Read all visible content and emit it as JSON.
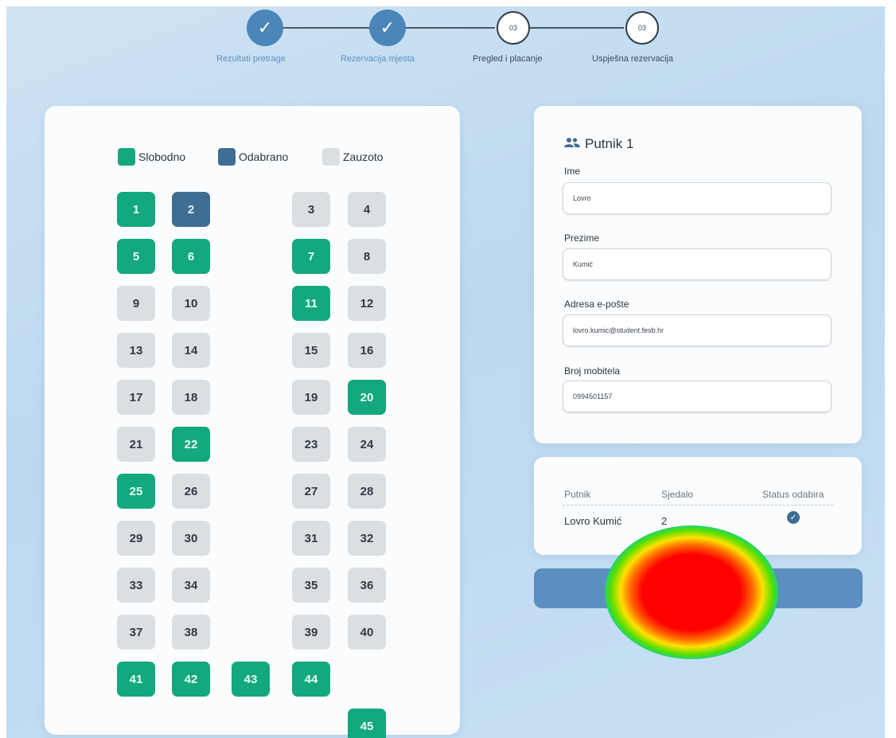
{
  "stepper": {
    "steps": [
      {
        "badge": "✓",
        "label": "Rezultati pretrage",
        "state": "done"
      },
      {
        "badge": "✓",
        "label": "Rezervacija mjesta",
        "state": "done"
      },
      {
        "badge": "03",
        "label": "Pregled i placanje",
        "state": "todo"
      },
      {
        "badge": "03",
        "label": "Uspješna rezervacija",
        "state": "todo"
      }
    ]
  },
  "legend": {
    "free": "Slobodno",
    "selected": "Odabrano",
    "taken": "Zauzoto"
  },
  "colors": {
    "free": "#13a87e",
    "selected": "#3f6d93",
    "taken": "#dcdfe2",
    "accent": "#5b8fbf"
  },
  "seats": [
    {
      "n": "1",
      "s": "free"
    },
    {
      "n": "2",
      "s": "selected"
    },
    {
      "n": "3",
      "s": "taken"
    },
    {
      "n": "4",
      "s": "taken"
    },
    {
      "n": "5",
      "s": "free"
    },
    {
      "n": "6",
      "s": "free"
    },
    {
      "n": "7",
      "s": "free"
    },
    {
      "n": "8",
      "s": "taken"
    },
    {
      "n": "9",
      "s": "taken"
    },
    {
      "n": "10",
      "s": "taken"
    },
    {
      "n": "11",
      "s": "free"
    },
    {
      "n": "12",
      "s": "taken"
    },
    {
      "n": "13",
      "s": "taken"
    },
    {
      "n": "14",
      "s": "taken"
    },
    {
      "n": "15",
      "s": "taken"
    },
    {
      "n": "16",
      "s": "taken"
    },
    {
      "n": "17",
      "s": "taken"
    },
    {
      "n": "18",
      "s": "taken"
    },
    {
      "n": "19",
      "s": "taken"
    },
    {
      "n": "20",
      "s": "free"
    },
    {
      "n": "21",
      "s": "taken"
    },
    {
      "n": "22",
      "s": "free"
    },
    {
      "n": "23",
      "s": "taken"
    },
    {
      "n": "24",
      "s": "taken"
    },
    {
      "n": "25",
      "s": "free"
    },
    {
      "n": "26",
      "s": "taken"
    },
    {
      "n": "27",
      "s": "taken"
    },
    {
      "n": "28",
      "s": "taken"
    },
    {
      "n": "29",
      "s": "taken"
    },
    {
      "n": "30",
      "s": "taken"
    },
    {
      "n": "31",
      "s": "taken"
    },
    {
      "n": "32",
      "s": "taken"
    },
    {
      "n": "33",
      "s": "taken"
    },
    {
      "n": "34",
      "s": "taken"
    },
    {
      "n": "35",
      "s": "taken"
    },
    {
      "n": "36",
      "s": "taken"
    },
    {
      "n": "37",
      "s": "taken"
    },
    {
      "n": "38",
      "s": "taken"
    },
    {
      "n": "39",
      "s": "taken"
    },
    {
      "n": "40",
      "s": "taken"
    },
    {
      "n": "41",
      "s": "free"
    },
    {
      "n": "42",
      "s": "free"
    },
    {
      "n": "43",
      "s": "free"
    },
    {
      "n": "44",
      "s": "free"
    },
    {
      "n": "45",
      "s": "free"
    }
  ],
  "passenger": {
    "title": "Putnik 1",
    "icon": "users-icon",
    "first_name_label": "Ime",
    "first_name_value": "Lovro",
    "last_name_label": "Prezime",
    "last_name_value": "Kumić",
    "email_label": "Adresa e-pošte",
    "email_value": "lovro.kumic@student.fesb.hr",
    "phone_label": "Broj mobitela",
    "phone_value": "0994501157"
  },
  "summary": {
    "headers": [
      "Putnik",
      "Sjedalo",
      "Status odabira"
    ],
    "rows": [
      {
        "passenger": "Lovro Kumić",
        "seat": "2",
        "status_icon": "check-circle-icon"
      }
    ]
  },
  "continue_button": {
    "label": ""
  }
}
